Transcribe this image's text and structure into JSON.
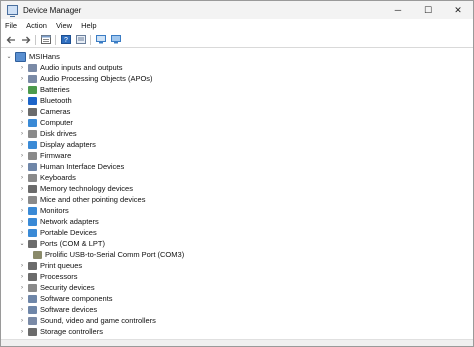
{
  "window": {
    "title": "Device Manager",
    "controls": {
      "minimize": "─",
      "maximize": "☐",
      "close": "✕"
    }
  },
  "menu": [
    "File",
    "Action",
    "View",
    "Help"
  ],
  "toolbar_icons": [
    "back-arrow-icon",
    "forward-arrow-icon",
    "properties-icon",
    "help-icon",
    "update-driver-icon",
    "monitor-icon"
  ],
  "tree": {
    "root": {
      "label": "MSIHans",
      "expanded": true
    },
    "categories": [
      {
        "label": "Audio inputs and outputs",
        "icon": "audio-icon",
        "color": "#7a8aa6"
      },
      {
        "label": "Audio Processing Objects (APOs)",
        "icon": "audio-processing-icon",
        "color": "#7a8aa6"
      },
      {
        "label": "Batteries",
        "icon": "battery-icon",
        "color": "#4c9a4c"
      },
      {
        "label": "Bluetooth",
        "icon": "bluetooth-icon",
        "color": "#1d64c8"
      },
      {
        "label": "Cameras",
        "icon": "camera-icon",
        "color": "#6b6b6b"
      },
      {
        "label": "Computer",
        "icon": "computer-icon",
        "color": "#3a8ad6"
      },
      {
        "label": "Disk drives",
        "icon": "disk-drive-icon",
        "color": "#8a8a8a"
      },
      {
        "label": "Display adapters",
        "icon": "display-adapter-icon",
        "color": "#3a8ad6"
      },
      {
        "label": "Firmware",
        "icon": "firmware-icon",
        "color": "#8a8a8a"
      },
      {
        "label": "Human Interface Devices",
        "icon": "hid-icon",
        "color": "#6f86a8"
      },
      {
        "label": "Keyboards",
        "icon": "keyboard-icon",
        "color": "#8a8a8a"
      },
      {
        "label": "Memory technology devices",
        "icon": "memory-icon",
        "color": "#6b6b6b"
      },
      {
        "label": "Mice and other pointing devices",
        "icon": "mouse-icon",
        "color": "#8a8a8a"
      },
      {
        "label": "Monitors",
        "icon": "monitor-icon",
        "color": "#3a8ad6"
      },
      {
        "label": "Network adapters",
        "icon": "network-adapter-icon",
        "color": "#3a8ad6"
      },
      {
        "label": "Portable Devices",
        "icon": "portable-device-icon",
        "color": "#3a8ad6"
      },
      {
        "label": "Ports (COM & LPT)",
        "icon": "port-icon",
        "color": "#6b6b6b",
        "expanded": true,
        "children": [
          {
            "label": "Prolific USB-to-Serial Comm Port (COM3)",
            "icon": "serial-port-icon",
            "color": "#8a8a6a"
          }
        ]
      },
      {
        "label": "Print queues",
        "icon": "printer-icon",
        "color": "#6b6b6b"
      },
      {
        "label": "Processors",
        "icon": "processor-icon",
        "color": "#6b6b6b"
      },
      {
        "label": "Security devices",
        "icon": "security-device-icon",
        "color": "#8a8a8a"
      },
      {
        "label": "Software components",
        "icon": "software-component-icon",
        "color": "#6f86a8"
      },
      {
        "label": "Software devices",
        "icon": "software-device-icon",
        "color": "#6f86a8"
      },
      {
        "label": "Sound, video and game controllers",
        "icon": "sound-icon",
        "color": "#7a8aa6"
      },
      {
        "label": "Storage controllers",
        "icon": "storage-controller-icon",
        "color": "#6b6b6b"
      }
    ]
  }
}
